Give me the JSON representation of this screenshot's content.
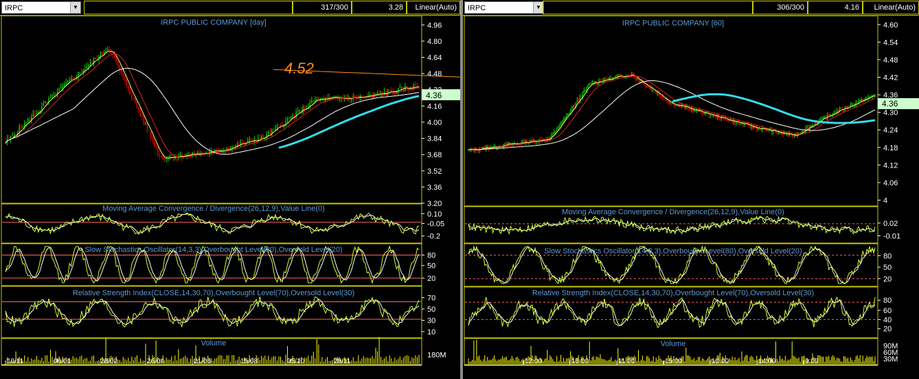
{
  "left": {
    "symbol": "IRPC",
    "counter": "317/300",
    "value": "3.28",
    "scale": "Linear(Auto)",
    "price_title": "IRPC PUBLIC COMPANY [day]",
    "last_price": "4.36",
    "annotation": "4.52",
    "price_ticks": [
      "4.96",
      "4.80",
      "4.64",
      "4.48",
      "4.32",
      "4.16",
      "4.00",
      "3.84",
      "3.68",
      "3.52",
      "3.36",
      "3.20"
    ],
    "macd_title": "Moving Average Convergence / Divergence(26,12,9),Value Line(0)",
    "macd_ticks": [
      "0.10",
      "-0.05",
      "-0.2"
    ],
    "stoch_title": "Slow Stochastics Oscillator(14,3,3),Overbought Level(80),Oversold Level(20)",
    "stoch_ticks": [
      "80",
      "50",
      "20"
    ],
    "rsi_title": "Relative Strength Index(CLOSE,14,30,70),Overbought Level(70),Oversold Level(30)",
    "rsi_ticks": [
      "70",
      "50",
      "30",
      "10"
    ],
    "volume_title": "Volume",
    "volume_ticks": [
      "180M"
    ],
    "date_labels": [
      "10/11",
      "06/01",
      "28/02",
      "26/04",
      "21/06",
      "15/08",
      "05/10",
      "28/11"
    ]
  },
  "right": {
    "symbol": "IRPC",
    "counter": "306/300",
    "value": "4.16",
    "scale": "Linear(Auto)",
    "price_title": "IRPC PUBLIC COMPANY [60]",
    "last_price": "4.36",
    "price_ticks": [
      "4.60",
      "4.54",
      "4.48",
      "4.42",
      "4.36",
      "4.30",
      "4.24",
      "4.18",
      "4.12",
      "4.06",
      "4"
    ],
    "macd_title": "Moving Average Convergence / Divergence(26,12,9),Value Line(0)",
    "macd_ticks": [
      "0.02",
      "-0.01"
    ],
    "stoch_title": "Slow Stochastics Oscillator(14,3,3),Overbought Level(80),Oversold Level(20)",
    "stoch_ticks": [
      "80",
      "50",
      "20"
    ],
    "rsi_title": "Relative Strength Index(CLOSE,14,30,70),Overbought Level(70),Oversold Level(30)",
    "rsi_ticks": [
      "80",
      "60",
      "40",
      "20"
    ],
    "volume_title": "Volume",
    "volume_ticks": [
      "90M",
      "60M",
      "30M"
    ],
    "time_labels": [
      "12:00",
      "16:00",
      "11:00",
      "15:00",
      "10:00",
      "14:00",
      "9:00"
    ]
  },
  "colors": {
    "up_candle": "#00dd00",
    "down_candle": "#ee0000",
    "ma_fast": "#ffff66",
    "ma_mid": "#dd2222",
    "ma_slow": "#ffffff",
    "ma_long": "#33ddee",
    "panel_border": "#c8c800",
    "title": "#5b9bd5",
    "level_line": "#ff6666",
    "annotation": "#ff8c1a",
    "oscillator": "#ccff33",
    "volume": "#ffff00"
  },
  "chart_data": [
    {
      "type": "line",
      "title": "IRPC PUBLIC COMPANY [day]",
      "x": [
        "10/11",
        "06/01",
        "28/02",
        "26/04",
        "21/06",
        "15/08",
        "05/10",
        "28/11"
      ],
      "series": [
        {
          "values": [
            3.8,
            4.3,
            4.74,
            3.65,
            3.7,
            3.85,
            4.22,
            4.25,
            4.36
          ]
        }
      ],
      "ylim": [
        3.2,
        5.0
      ],
      "annotations": [
        "4.52"
      ],
      "last_price": 4.36
    },
    {
      "type": "line",
      "title": "IRPC PUBLIC COMPANY [60]",
      "x": [
        "12:00",
        "16:00",
        "11:00",
        "15:00",
        "10:00",
        "14:00",
        "9:00"
      ],
      "series": [
        {
          "values": [
            4.17,
            4.19,
            4.21,
            4.4,
            4.43,
            4.33,
            4.29,
            4.25,
            4.22,
            4.3,
            4.36
          ]
        }
      ],
      "ylim": [
        4.0,
        4.62
      ],
      "last_price": 4.36
    }
  ]
}
